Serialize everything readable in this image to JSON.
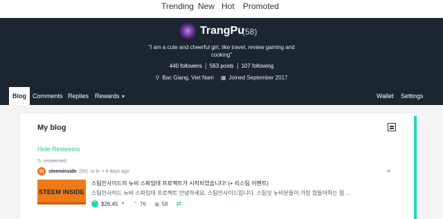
{
  "topnav": {
    "items": [
      "Trending",
      "New",
      "Hot",
      "Promoted"
    ]
  },
  "profile": {
    "name": "TrangPu",
    "reputation": "(58)",
    "bio": "\"I am a cute and cheerful girl, like travel, review gaming and cooking\"",
    "followers": "440 followers",
    "posts": "563 posts",
    "following": "107 following",
    "location": "Bac Giang, Viet Nam",
    "joined": "Joined September 2017"
  },
  "tabs": {
    "blog": "Blog",
    "comments": "Comments",
    "replies": "Replies",
    "rewards": "Rewards",
    "wallet": "Wallet",
    "settings": "Settings"
  },
  "blog": {
    "title": "My blog",
    "hide_resteems": "Hide Resteems"
  },
  "post": {
    "resteemed_label": "resteemed",
    "author_initial": "SI",
    "author": "steeminside",
    "author_rep": "(56)",
    "category": "in kr",
    "time": "• 4 days ago",
    "thumbnail_text": "STEEM INSIDE",
    "title": "스팀인사이드의 뉴비 스파임대 프로젝트가 시작되었습니다! (+ 리스팀 이벤트)",
    "body": "스팀인사이드 뉴비 스파임대 프로젝트 안녕하세요, 스팀인사이드입니다. 스팀잇 뉴비분들이 가장 힘들어하는 점 ...",
    "payout": "$26.45",
    "votes": "76",
    "comments": "58"
  },
  "colors": {
    "header_bg": "#1b2631",
    "accent": "#1fd8b3",
    "link": "#2fbf9f",
    "thumbnail": "#ef7a1a"
  },
  "icons": {
    "location": "map-pin-icon",
    "calendar": "calendar-icon",
    "layout": "layout-toggle-icon",
    "resteem": "resteem-icon",
    "flag": "flag-icon",
    "upvote": "upvote-icon",
    "votes": "votes-icon",
    "comments": "comments-icon"
  }
}
